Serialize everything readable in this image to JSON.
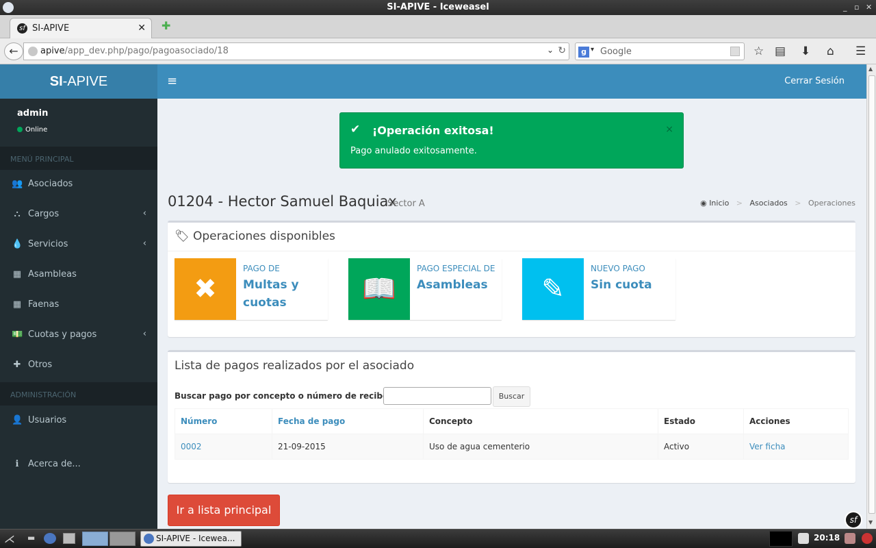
{
  "window": {
    "title": "SI-APIVE - Iceweasel",
    "controls": [
      "_",
      "▫",
      "✕"
    ]
  },
  "browser": {
    "tab_label": "SI-APIVE",
    "url_host": "apive",
    "url_path": "/app_dev.php/pago/pagoasociado/18",
    "search_placeholder": "Google"
  },
  "header": {
    "logo_bold": "SI",
    "logo_rest": "-APIVE",
    "logout_label": "Cerrar Sesión"
  },
  "sidebar": {
    "user_name": "admin",
    "user_status": "Online",
    "section_main": "MENÚ PRINCIPAL",
    "section_admin": "ADMINISTRACIÓN",
    "items": [
      {
        "label": "Asociados"
      },
      {
        "label": "Cargos"
      },
      {
        "label": "Servicios"
      },
      {
        "label": "Asambleas"
      },
      {
        "label": "Faenas"
      },
      {
        "label": "Cuotas y pagos"
      },
      {
        "label": "Otros"
      },
      {
        "label": "Usuarios"
      },
      {
        "label": "Acerca de..."
      }
    ]
  },
  "alert": {
    "title": "¡Operación exitosa!",
    "message": "Pago anulado exitosamente.",
    "close": "×"
  },
  "page": {
    "title": "01204 - Hector Samuel Baquiax",
    "subtitle": "Sector A",
    "breadcrumb": [
      "Inicio",
      "Asociados",
      "Operaciones"
    ],
    "breadcrumb_sep": ">"
  },
  "operations": {
    "title": "Operaciones disponibles",
    "boxes": [
      {
        "small": "PAGO DE",
        "big": "Multas y cuotas",
        "color": "#f39c12"
      },
      {
        "small": "PAGO ESPECIAL DE",
        "big": "Asambleas",
        "color": "#00a65a"
      },
      {
        "small": "NUEVO PAGO",
        "big": "Sin cuota",
        "color": "#00c0ef"
      }
    ]
  },
  "payments": {
    "title": "Lista de pagos realizados por el asociado",
    "search_label": "Buscar pago por concepto o número de recibo:",
    "search_value": "",
    "search_button": "Buscar",
    "columns": [
      "Número",
      "Fecha de pago",
      "Concepto",
      "Estado",
      "Acciones"
    ],
    "rows": [
      {
        "numero": "0002",
        "fecha": "21-09-2015",
        "concepto": "Uso de agua cementerio",
        "estado": "Activo",
        "accion": "Ver ficha"
      }
    ]
  },
  "main_button": "Ir a lista principal",
  "taskbar": {
    "task_label": "SI-APIVE - Icewea...",
    "clock": "20:18"
  }
}
